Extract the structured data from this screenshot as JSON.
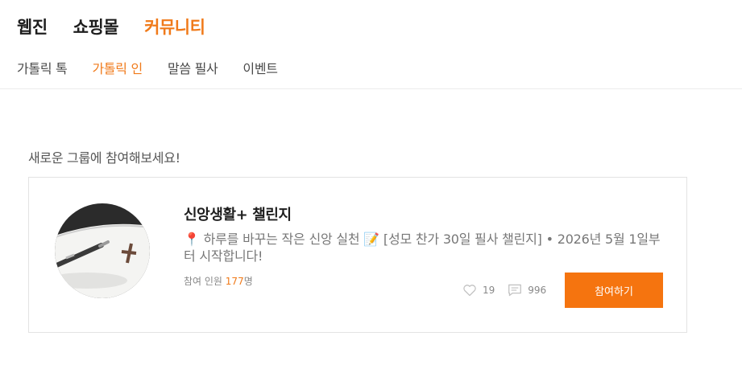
{
  "top_nav": {
    "items": [
      {
        "label": "웹진"
      },
      {
        "label": "쇼핑몰"
      },
      {
        "label": "커뮤니티"
      }
    ],
    "active_index": 2
  },
  "sub_nav": {
    "items": [
      {
        "label": "가톨릭 톡"
      },
      {
        "label": "가톨릭 인"
      },
      {
        "label": "말씀 필사"
      },
      {
        "label": "이벤트"
      }
    ],
    "active_index": 1
  },
  "section": {
    "title": "새로운 그룹에 참여해보세요!"
  },
  "group_card": {
    "title": "신앙생활+ 챌린지",
    "pin_emoji": "📍",
    "memo_emoji": "📝",
    "description_part1": " 하루를 바꾸는 작은 신앙 실천 ",
    "description_part2": "[성모 찬가 30일 필사 챌린지] • 2026년 5월 1일부터 시작합니다!",
    "members_label": "참여 인원 ",
    "members_count": "177",
    "members_suffix": "명",
    "likes": "19",
    "comments": "996",
    "join_label": "참여하기",
    "thumbnail_icon": "pen-and-cross-image"
  },
  "colors": {
    "accent": "#f5740f",
    "active_text": "#f07a1a"
  }
}
